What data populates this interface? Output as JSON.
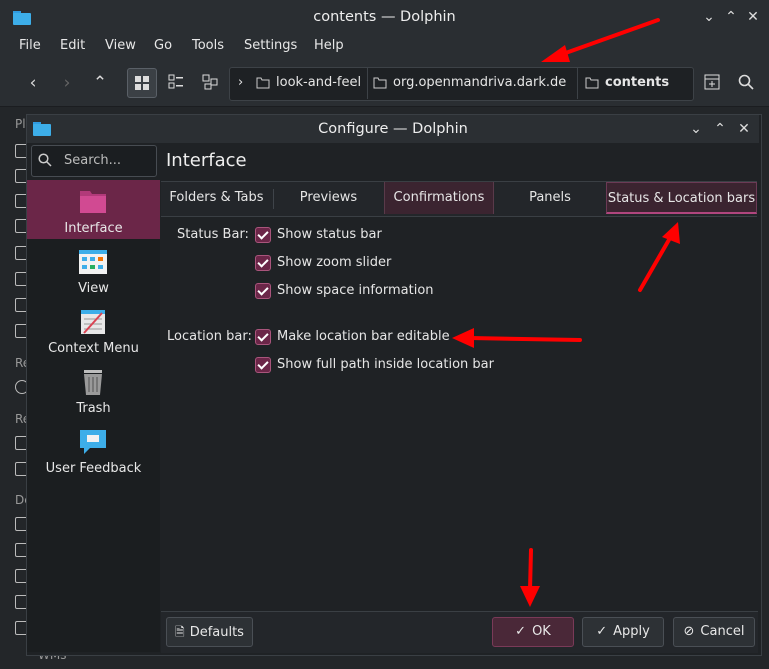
{
  "window": {
    "title": "contents — Dolphin"
  },
  "menu": [
    "File",
    "Edit",
    "View",
    "Go",
    "Tools",
    "Settings",
    "Help"
  ],
  "breadcrumbs": [
    "look-and-feel",
    "org.openmandriva.dark.desk",
    "contents"
  ],
  "sidebar_labels": [
    "Pl",
    "Re",
    "Re",
    "De",
    "WMs"
  ],
  "dialog": {
    "title": "Configure — Dolphin",
    "search_placeholder": "Search...",
    "header": "Interface",
    "categories": [
      "Interface",
      "View",
      "Context Menu",
      "Trash",
      "User Feedback"
    ],
    "tabs": [
      "Folders & Tabs",
      "Previews",
      "Confirmations",
      "Panels",
      "Status & Location bars"
    ],
    "status_bar_label": "Status Bar:",
    "status_options": [
      "Show status bar",
      "Show zoom slider",
      "Show space information"
    ],
    "location_bar_label": "Location bar:",
    "location_options": [
      "Make location bar editable",
      "Show full path inside location bar"
    ],
    "buttons": {
      "defaults": "Defaults",
      "ok": "OK",
      "apply": "Apply",
      "cancel": "Cancel"
    }
  },
  "colors": {
    "accent": "#6b2648",
    "annotation": "#ff0000"
  }
}
